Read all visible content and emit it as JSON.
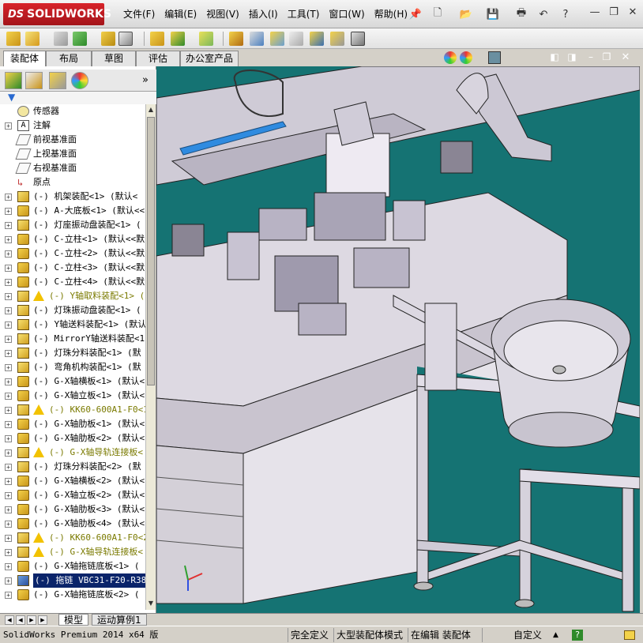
{
  "app": {
    "logo": "SOLIDWORKS",
    "logo_mark": "DS"
  },
  "menus": [
    "文件(F)",
    "编辑(E)",
    "视图(V)",
    "插入(I)",
    "工具(T)",
    "窗口(W)",
    "帮助(H)"
  ],
  "command_tabs": [
    "装配体",
    "布局",
    "草图",
    "评估",
    "办公室产品"
  ],
  "active_command_tab": "装配体",
  "feature_tree": {
    "rows": [
      {
        "label": "传感器",
        "icon": "sensor-icon",
        "expandable": false,
        "kind": "sensor"
      },
      {
        "label": "注解",
        "icon": "annotation-icon",
        "expandable": true,
        "kind": "annotation"
      },
      {
        "label": "前视基准面",
        "icon": "plane-icon",
        "expandable": false,
        "kind": "plane"
      },
      {
        "label": "上视基准面",
        "icon": "plane-icon",
        "expandable": false,
        "kind": "plane"
      },
      {
        "label": "右视基准面",
        "icon": "plane-icon",
        "expandable": false,
        "kind": "plane"
      },
      {
        "label": "原点",
        "icon": "origin-icon",
        "expandable": false,
        "kind": "origin"
      },
      {
        "label": "(-) 机架装配<1> (默认<",
        "icon": "assembly-icon",
        "expandable": true,
        "kind": "asm"
      },
      {
        "label": "(-) A-大底板<1> (默认<<",
        "icon": "part-icon",
        "expandable": true,
        "kind": "part"
      },
      {
        "label": "(-) 灯座振动盘装配<1> (",
        "icon": "assembly-icon",
        "expandable": true,
        "kind": "asm"
      },
      {
        "label": "(-) C-立柱<1> (默认<<默",
        "icon": "part-icon",
        "expandable": true,
        "kind": "part"
      },
      {
        "label": "(-) C-立柱<2> (默认<<默",
        "icon": "part-icon",
        "expandable": true,
        "kind": "part"
      },
      {
        "label": "(-) C-立柱<3> (默认<<默",
        "icon": "part-icon",
        "expandable": true,
        "kind": "part"
      },
      {
        "label": "(-) C-立柱<4> (默认<<默",
        "icon": "part-icon",
        "expandable": true,
        "kind": "part"
      },
      {
        "label": "(-) Y轴取料装配<1> (",
        "icon": "assembly-icon",
        "expandable": true,
        "kind": "asm",
        "warning": true
      },
      {
        "label": "(-) 灯珠振动盘装配<1> (",
        "icon": "assembly-icon",
        "expandable": true,
        "kind": "asm"
      },
      {
        "label": "(-) Y轴送料装配<1> (默认",
        "icon": "assembly-icon",
        "expandable": true,
        "kind": "asm"
      },
      {
        "label": "(-) MirrorY轴送料装配<1",
        "icon": "assembly-icon",
        "expandable": true,
        "kind": "asm"
      },
      {
        "label": "(-) 灯珠分料装配<1> (默",
        "icon": "assembly-icon",
        "expandable": true,
        "kind": "asm"
      },
      {
        "label": "(-) 弯角机构装配<1> (默",
        "icon": "assembly-icon",
        "expandable": true,
        "kind": "asm"
      },
      {
        "label": "(-) G-X轴横板<1> (默认<",
        "icon": "part-icon",
        "expandable": true,
        "kind": "part"
      },
      {
        "label": "(-) G-X轴立板<1> (默认<",
        "icon": "part-icon",
        "expandable": true,
        "kind": "part"
      },
      {
        "label": "(-) KK60-600A1-F0<1>",
        "icon": "assembly-icon",
        "expandable": true,
        "kind": "asm",
        "warning": true
      },
      {
        "label": "(-) G-X轴肋板<1> (默认<",
        "icon": "part-icon",
        "expandable": true,
        "kind": "part"
      },
      {
        "label": "(-) G-X轴肋板<2> (默认<",
        "icon": "part-icon",
        "expandable": true,
        "kind": "part"
      },
      {
        "label": "(-) G-X轴导轨连接板<",
        "icon": "assembly-icon",
        "expandable": true,
        "kind": "asm",
        "warning": true
      },
      {
        "label": "(-) 灯珠分料装配<2> (默",
        "icon": "assembly-icon",
        "expandable": true,
        "kind": "asm"
      },
      {
        "label": "(-) G-X轴横板<2> (默认<",
        "icon": "part-icon",
        "expandable": true,
        "kind": "part"
      },
      {
        "label": "(-) G-X轴立板<2> (默认<",
        "icon": "part-icon",
        "expandable": true,
        "kind": "part"
      },
      {
        "label": "(-) G-X轴肋板<3> (默认<",
        "icon": "part-icon",
        "expandable": true,
        "kind": "part"
      },
      {
        "label": "(-) G-X轴肋板<4> (默认<",
        "icon": "part-icon",
        "expandable": true,
        "kind": "part"
      },
      {
        "label": "(-) KK60-600A1-F0<2>",
        "icon": "assembly-icon",
        "expandable": true,
        "kind": "asm",
        "warning": true
      },
      {
        "label": "(-) G-X轴导轨连接板<",
        "icon": "assembly-icon",
        "expandable": true,
        "kind": "asm",
        "warning": true
      },
      {
        "label": "(-) G-X轴拖链底板<1> (",
        "icon": "part-icon",
        "expandable": true,
        "kind": "part"
      },
      {
        "label": "(-) 拖链 VBC31-F20-R38",
        "icon": "assembly-icon",
        "expandable": true,
        "kind": "asm",
        "selected": true
      },
      {
        "label": "(-) G-X轴拖链底板<2> (",
        "icon": "part-icon",
        "expandable": true,
        "kind": "part"
      }
    ]
  },
  "bottom_tabs": [
    "模型",
    "运动算例1"
  ],
  "active_bottom_tab": "模型",
  "status": {
    "product": "SolidWorks Premium 2014 x64 版",
    "constraint": "完全定义",
    "mode": "大型装配体模式",
    "editing": "在编辑 装配体",
    "units": "自定义"
  },
  "colors": {
    "viewport_bg": "#157373",
    "brand_red": "#c41e24",
    "selection": "#0a246a",
    "warning_text": "#7a7a00"
  }
}
